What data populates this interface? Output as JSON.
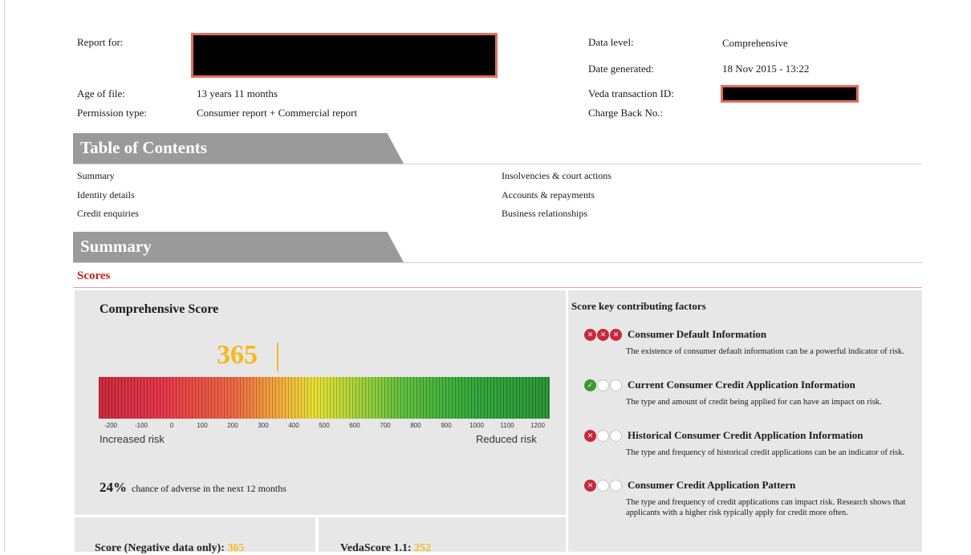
{
  "header": {
    "report_for_label": "Report for:",
    "age_of_file_label": "Age of file:",
    "age_of_file_value": "13 years 11 months",
    "permission_type_label": "Permission type:",
    "permission_type_value": "Consumer report + Commercial report",
    "data_level_label": "Data level:",
    "data_level_value": "Comprehensive",
    "date_generated_label": "Date generated:",
    "date_generated_value": "18 Nov 2015 - 13:22",
    "veda_transaction_label": "Veda transaction ID:",
    "charge_back_label": "Charge Back No.:"
  },
  "toc": {
    "title": "Table of Contents",
    "left": [
      "Summary",
      "Identity details",
      "Credit enquiries"
    ],
    "right": [
      "Insolvencies & court actions",
      "Accounts & repayments",
      "Business relationships"
    ]
  },
  "summary": {
    "title": "Summary",
    "scores_label": "Scores",
    "score_title": "Comprehensive Score",
    "score_value": "365",
    "score_numeric": 365,
    "ticks": [
      "-200",
      "-100",
      "0",
      "100",
      "200",
      "300",
      "400",
      "500",
      "600",
      "700",
      "800",
      "900",
      "1000",
      "1100",
      "1200"
    ],
    "increased_risk": "Increased risk",
    "reduced_risk": "Reduced risk",
    "chance_pct": "24%",
    "chance_text": "chance of adverse in the next 12 months",
    "bottom_left_label": "Score (Negative data only):",
    "bottom_left_value": "365",
    "bottom_right_label": "VedaScore 1.1:",
    "bottom_right_value": "252"
  },
  "factors": {
    "title": "Score key contributing factors",
    "items": [
      {
        "title": "Consumer Default Information",
        "desc": "The existence of consumer default information can be a powerful indicator of risk.",
        "icons": [
          "red-x",
          "red-x",
          "red-x"
        ]
      },
      {
        "title": "Current Consumer Credit Application Information",
        "desc": "The type and amount of credit being applied for can have an impact on risk.",
        "icons": [
          "green-check",
          "empty",
          "empty"
        ]
      },
      {
        "title": "Historical Consumer Credit Application Information",
        "desc": "The type and frequency of historical credit applications can be an indicator of risk.",
        "icons": [
          "red-x",
          "empty",
          "empty"
        ]
      },
      {
        "title": "Consumer Credit Application Pattern",
        "desc": "The type and frequency of credit applications can impact risk. Research shows that applicants with a higher risk typically apply for credit more often.",
        "icons": [
          "red-x",
          "empty",
          "empty"
        ]
      }
    ]
  },
  "colors": {
    "accent_red": "#c8201c",
    "score_yellow": "#f6b91a",
    "tab_grey": "#9a9a9a",
    "redaction_border": "#e0705c"
  }
}
